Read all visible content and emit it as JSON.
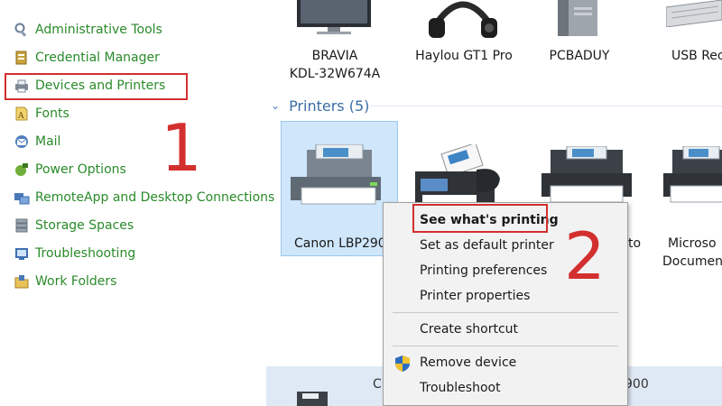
{
  "sidebar": {
    "items": [
      {
        "label": "Administrative Tools",
        "icon": "administrative-tools-icon"
      },
      {
        "label": "Credential Manager",
        "icon": "credential-manager-icon"
      },
      {
        "label": "Devices and Printers",
        "icon": "devices-and-printers-icon"
      },
      {
        "label": "Fonts",
        "icon": "fonts-icon"
      },
      {
        "label": "Mail",
        "icon": "mail-icon"
      },
      {
        "label": "Power Options",
        "icon": "power-options-icon"
      },
      {
        "label": "RemoteApp and Desktop Connections",
        "icon": "remoteapp-icon"
      },
      {
        "label": "Storage Spaces",
        "icon": "storage-spaces-icon"
      },
      {
        "label": "Troubleshooting",
        "icon": "troubleshooting-icon"
      },
      {
        "label": "Work Folders",
        "icon": "work-folders-icon"
      }
    ]
  },
  "annotations": {
    "step1": "1",
    "step2": "2"
  },
  "devices": {
    "items": [
      {
        "line1": "BRAVIA",
        "line2": "KDL-32W674A",
        "icon": "tv-icon"
      },
      {
        "line1": "Haylou GT1 Pro",
        "line2": "",
        "icon": "headphones-icon"
      },
      {
        "line1": "PCBADUY",
        "line2": "",
        "icon": "computer-tower-icon"
      },
      {
        "line1": "USB Rec",
        "line2": "",
        "icon": "keyboard-icon"
      }
    ]
  },
  "printers_group": {
    "header": "Printers (5)",
    "items": [
      {
        "line1": "Canon LBP2900",
        "line2": "",
        "icon": "printer-icon"
      },
      {
        "line1": "",
        "line2": "",
        "icon": "fax-icon"
      },
      {
        "line1": "to",
        "line2": "",
        "icon": "printer-icon"
      },
      {
        "line1": "Microso",
        "line2": "Documen",
        "icon": "printer-icon"
      }
    ],
    "bottom_text_left": "C",
    "bottom_text_right": "900"
  },
  "context_menu": {
    "items": [
      {
        "label": "See what's printing",
        "bold": true
      },
      {
        "label": "Set as default printer"
      },
      {
        "label": "Printing preferences"
      },
      {
        "label": "Printer properties"
      },
      {
        "label": "Create shortcut"
      },
      {
        "label": "Remove device",
        "icon": "shield-icon"
      },
      {
        "label": "Troubleshoot"
      }
    ]
  },
  "colors": {
    "link_green": "#2a8a2a",
    "highlight_red": "#d32f2f",
    "group_blue": "#3a6ea5",
    "selection_blue": "#cfe6fb"
  }
}
